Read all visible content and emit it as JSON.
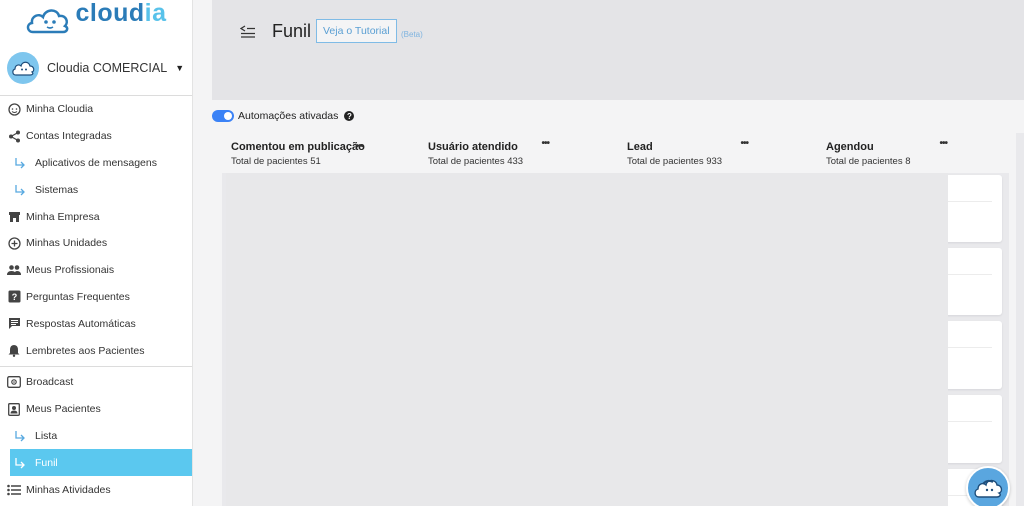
{
  "logo": {
    "part1": "cloud",
    "part2": "ia"
  },
  "account": {
    "name": "Cloudia COMERCIAL"
  },
  "menu": {
    "minha_cloudia": "Minha Cloudia",
    "contas_integradas": "Contas Integradas",
    "aplicativos": "Aplicativos de mensagens",
    "sistemas": "Sistemas",
    "minha_empresa": "Minha Empresa",
    "minhas_unidades": "Minhas Unidades",
    "meus_profissionais": "Meus Profissionais",
    "perguntas": "Perguntas Frequentes",
    "respostas": "Respostas Automáticas",
    "lembretes": "Lembretes aos Pacientes",
    "broadcast": "Broadcast",
    "meus_pacientes": "Meus Pacientes",
    "lista": "Lista",
    "funil": "Funil",
    "minhas_atividades": "Minhas Atividades"
  },
  "header": {
    "title": "Funil",
    "tutorial_label": "Veja o Tutorial",
    "beta_label": "(Beta)"
  },
  "automation": {
    "label": "Automações ativadas",
    "enabled": true
  },
  "columns": [
    {
      "title": "Comentou em publicação",
      "subtitle": "Total de pacientes 51"
    },
    {
      "title": "Usuário atendido",
      "subtitle": "Total de pacientes 433"
    },
    {
      "title": "Lead",
      "subtitle": "Total de pacientes 933"
    },
    {
      "title": "Agendou",
      "subtitle": "Total de pacientes 8"
    }
  ],
  "colors": {
    "accent": "#5bc8ef",
    "toggle": "#3b82f6",
    "brand": "#2b7cb8"
  }
}
